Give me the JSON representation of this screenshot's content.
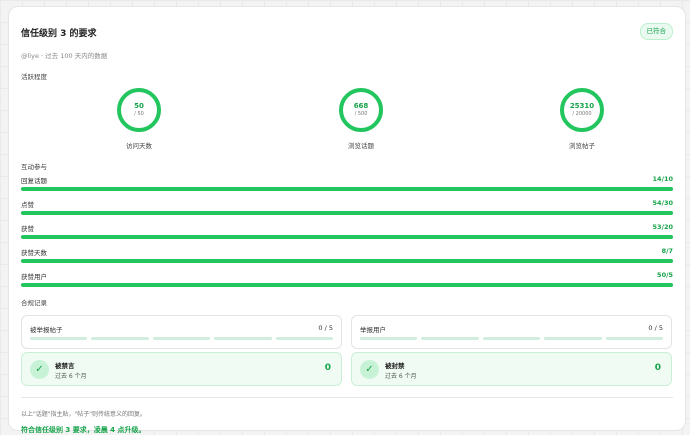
{
  "header": {
    "title": "信任级别 3 的要求",
    "badge": "已符合",
    "subtitle": "@liye · 过去 100 天内的数据"
  },
  "activity": {
    "label": "活跃程度",
    "rings": [
      {
        "value": "50",
        "goal": "/ 50",
        "label": "访问天数",
        "progress": 1.0
      },
      {
        "value": "668",
        "goal": "/ 500",
        "label": "浏览话题",
        "progress": 1.0
      },
      {
        "value": "25310",
        "goal": "/ 20000",
        "label": "浏览帖子",
        "progress": 1.0
      }
    ]
  },
  "interaction": {
    "label": "互动参与",
    "bars": [
      {
        "label": "回复话题",
        "count": "14/10",
        "progress": 1.0
      },
      {
        "label": "点赞",
        "count": "54/30",
        "progress": 1.0
      },
      {
        "label": "获赞",
        "count": "53/20",
        "progress": 1.0
      },
      {
        "label": "获赞天数",
        "count": "8/7",
        "progress": 1.0
      },
      {
        "label": "获赞用户",
        "count": "50/5",
        "progress": 1.0
      }
    ]
  },
  "penalty": {
    "label": "合规记录",
    "boxes": [
      {
        "label": "被举报帖子",
        "count": "0 / 5"
      },
      {
        "label": "举报用户",
        "count": "0 / 5"
      }
    ],
    "ok": [
      {
        "title": "被禁言",
        "sub": "过去 6 个月",
        "num": "0"
      },
      {
        "title": "被封禁",
        "sub": "过去 6 个月",
        "num": "0"
      }
    ]
  },
  "footer": {
    "note": "以上\"话题\"指主贴，\"帖子\"则传统意义的回复。",
    "summary": "符合信任级别 3 要求，凌晨 4 点升级。"
  },
  "colors": {
    "accent": "#22c55e",
    "accent_dark": "#16a34a",
    "track": "#dff6e7"
  }
}
